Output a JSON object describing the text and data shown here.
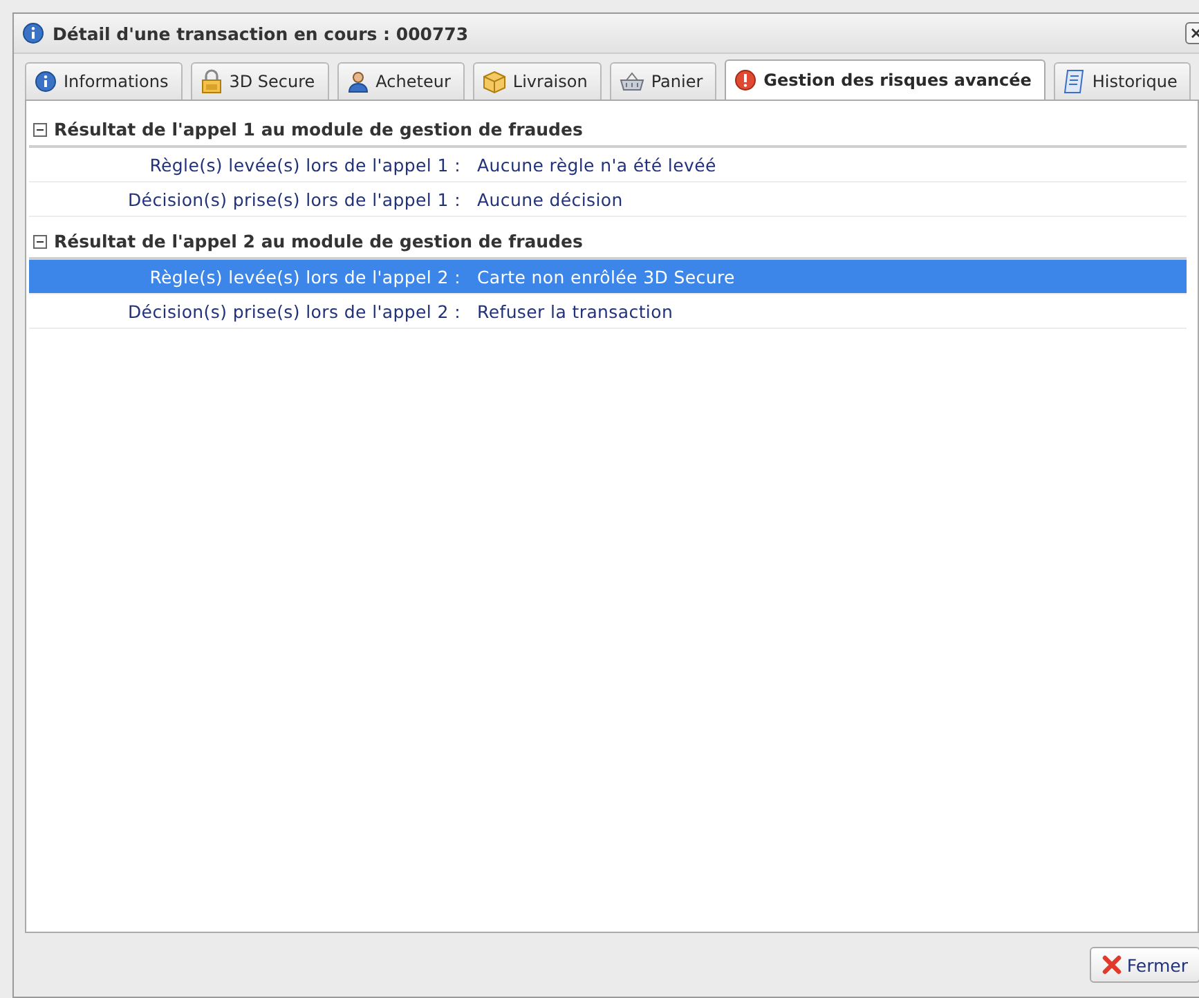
{
  "window": {
    "title": "Détail d'une transaction en cours : 000773"
  },
  "tabs": [
    {
      "label": "Informations",
      "selected": false
    },
    {
      "label": "3D Secure",
      "selected": false
    },
    {
      "label": "Acheteur",
      "selected": false
    },
    {
      "label": "Livraison",
      "selected": false
    },
    {
      "label": "Panier",
      "selected": false
    },
    {
      "label": "Gestion des risques avancée",
      "selected": true
    },
    {
      "label": "Historique",
      "selected": false
    }
  ],
  "groups": [
    {
      "title": "Résultat de l'appel 1 au module de gestion de fraudes",
      "expanded": true,
      "rows": [
        {
          "label": "Règle(s) levée(s) lors de l'appel 1 :",
          "value": "Aucune règle n'a été levéé",
          "selected": false
        },
        {
          "label": "Décision(s) prise(s) lors de l'appel 1 :",
          "value": "Aucune décision",
          "selected": false
        }
      ]
    },
    {
      "title": "Résultat de l'appel 2 au module de gestion de fraudes",
      "expanded": true,
      "rows": [
        {
          "label": "Règle(s) levée(s) lors de l'appel 2 :",
          "value": "Carte non enrôlée 3D Secure",
          "selected": true
        },
        {
          "label": "Décision(s) prise(s) lors de l'appel 2 :",
          "value": "Refuser la transaction",
          "selected": false
        }
      ]
    }
  ],
  "buttons": [
    {
      "label": "Fermer"
    }
  ]
}
